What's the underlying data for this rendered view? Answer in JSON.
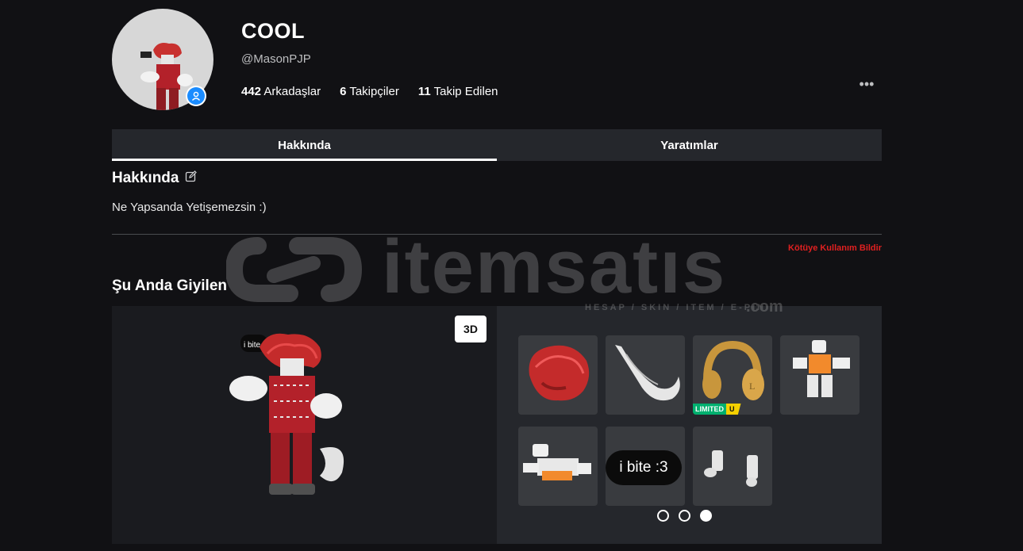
{
  "profile": {
    "display_name": "COOL",
    "username": "@MasonPJP",
    "stats": {
      "friends_count": "442",
      "friends_label": "Arkadaşlar",
      "followers_count": "6",
      "followers_label": "Takipçiler",
      "following_count": "11",
      "following_label": "Takip Edilen"
    },
    "more_icon": "ellipsis-icon",
    "more_glyph": "•••"
  },
  "tabs": [
    {
      "label": "Hakkında",
      "active": true
    },
    {
      "label": "Yaratımlar",
      "active": false
    }
  ],
  "about": {
    "title": "Hakkında",
    "edit_icon": "edit-icon",
    "description": "Ne Yapsanda Yetişemezsin :)",
    "report_label": "Kötüye Kullanım Bildir"
  },
  "wearing": {
    "title": "Şu Anda Giyilen",
    "view_3d_label": "3D",
    "avatar_speech_label": "i bite",
    "items": [
      {
        "name": "red-hair"
      },
      {
        "name": "white-tail"
      },
      {
        "name": "gold-headphones",
        "badge_limited": "LIMITED",
        "badge_u": "U"
      },
      {
        "name": "orange-shirt-figure"
      },
      {
        "name": "orange-pants-figure"
      },
      {
        "name": "speech-bubble",
        "bubble_text": "i bite :3"
      },
      {
        "name": "white-arms"
      }
    ],
    "pages": 3,
    "current_page": 3
  },
  "watermark": {
    "brand": "itemsatıs",
    "tagline": "HESAP / SKIN / ITEM / E-PIN",
    "suffix": ".com"
  },
  "colors": {
    "background": "#111114",
    "tab_bg": "#25272c",
    "card_bg": "#393b3f",
    "report_red": "#e02020",
    "presence_blue": "#1a8cff",
    "limited_green": "#00b06f",
    "limited_yellow": "#f5d000"
  }
}
